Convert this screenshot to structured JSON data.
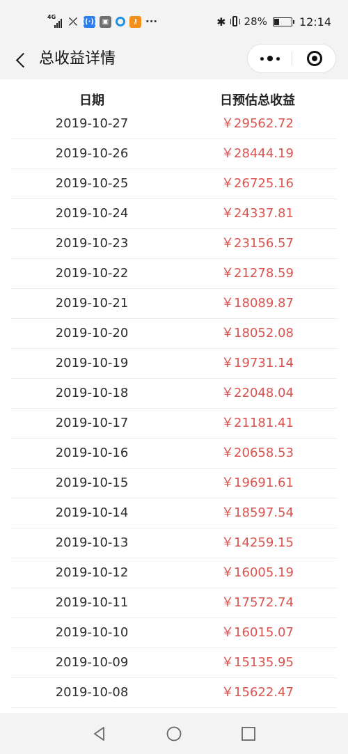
{
  "status_bar": {
    "network_label": "4G",
    "battery_percent": "28%",
    "time": "12:14",
    "icons": [
      "signal-icon",
      "missed-call-icon",
      "wifi-hotspot-icon",
      "app-icon",
      "app-ring-icon",
      "app-key-icon",
      "more-notifications-icon",
      "bluetooth-icon",
      "vibrate-icon",
      "battery-icon"
    ]
  },
  "header": {
    "title": "总收益详情",
    "back_icon": "chevron-left-icon",
    "more_icon": "more-dots-icon",
    "close_icon": "target-close-icon"
  },
  "table": {
    "columns": [
      "日期",
      "日预估总收益"
    ],
    "rows": [
      {
        "date": "2019-10-27",
        "income": "￥29562.72"
      },
      {
        "date": "2019-10-26",
        "income": "￥28444.19"
      },
      {
        "date": "2019-10-25",
        "income": "￥26725.16"
      },
      {
        "date": "2019-10-24",
        "income": "￥24337.81"
      },
      {
        "date": "2019-10-23",
        "income": "￥23156.57"
      },
      {
        "date": "2019-10-22",
        "income": "￥21278.59"
      },
      {
        "date": "2019-10-21",
        "income": "￥18089.87"
      },
      {
        "date": "2019-10-20",
        "income": "￥18052.08"
      },
      {
        "date": "2019-10-19",
        "income": "￥19731.14"
      },
      {
        "date": "2019-10-18",
        "income": "￥22048.04"
      },
      {
        "date": "2019-10-17",
        "income": "￥21181.41"
      },
      {
        "date": "2019-10-16",
        "income": "￥20658.53"
      },
      {
        "date": "2019-10-15",
        "income": "￥19691.61"
      },
      {
        "date": "2019-10-14",
        "income": "￥18597.54"
      },
      {
        "date": "2019-10-13",
        "income": "￥14259.15"
      },
      {
        "date": "2019-10-12",
        "income": "￥16005.19"
      },
      {
        "date": "2019-10-11",
        "income": "￥17572.74"
      },
      {
        "date": "2019-10-10",
        "income": "￥16015.07"
      },
      {
        "date": "2019-10-09",
        "income": "￥15135.95"
      },
      {
        "date": "2019-10-08",
        "income": "￥15622.47"
      }
    ]
  },
  "nav_bar": {
    "icons": [
      "nav-back-icon",
      "nav-home-icon",
      "nav-recent-icon"
    ]
  },
  "colors": {
    "income_text": "#d9534f",
    "date_text": "#2b2b2b",
    "background": "#f3f3f3",
    "content_background": "#ffffff"
  }
}
